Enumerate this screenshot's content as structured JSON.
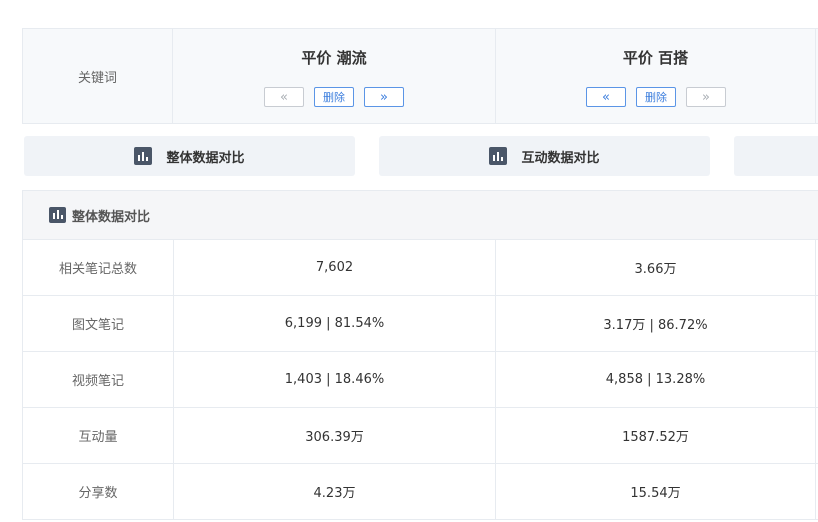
{
  "header": {
    "keyword_label": "关键词",
    "columns": [
      {
        "title": "平价 潮流",
        "prev_label": "«",
        "delete_label": "删除",
        "next_label": "»",
        "prev_enabled": false,
        "next_enabled": true
      },
      {
        "title": "平价 百搭",
        "prev_label": "«",
        "delete_label": "删除",
        "next_label": "»",
        "prev_enabled": true,
        "next_enabled": false
      }
    ]
  },
  "tabs": [
    {
      "label": "整体数据对比",
      "icon": "bar-chart-icon"
    },
    {
      "label": "互动数据对比",
      "icon": "bar-chart-icon"
    },
    {
      "label": "",
      "icon": ""
    }
  ],
  "section": {
    "title": "整体数据对比",
    "icon": "bar-chart-icon",
    "rows": [
      {
        "label": "相关笔记总数",
        "values": [
          "7,602",
          "3.66万"
        ]
      },
      {
        "label": "图文笔记",
        "values": [
          "6,199 | 81.54%",
          "3.17万 | 86.72%"
        ]
      },
      {
        "label": "视频笔记",
        "values": [
          "1,403 | 18.46%",
          "4,858 | 13.28%"
        ]
      },
      {
        "label": "互动量",
        "values": [
          "306.39万",
          "1587.52万"
        ]
      },
      {
        "label": "分享数",
        "values": [
          "4.23万",
          "15.54万"
        ]
      }
    ]
  },
  "colors": {
    "accent": "#3b7ddd",
    "border": "#e7ebf0",
    "header_bg": "#f7f9fb",
    "tab_bg": "#f0f3f7",
    "icon": "#4a5668",
    "disabled": "#a8adb3"
  }
}
